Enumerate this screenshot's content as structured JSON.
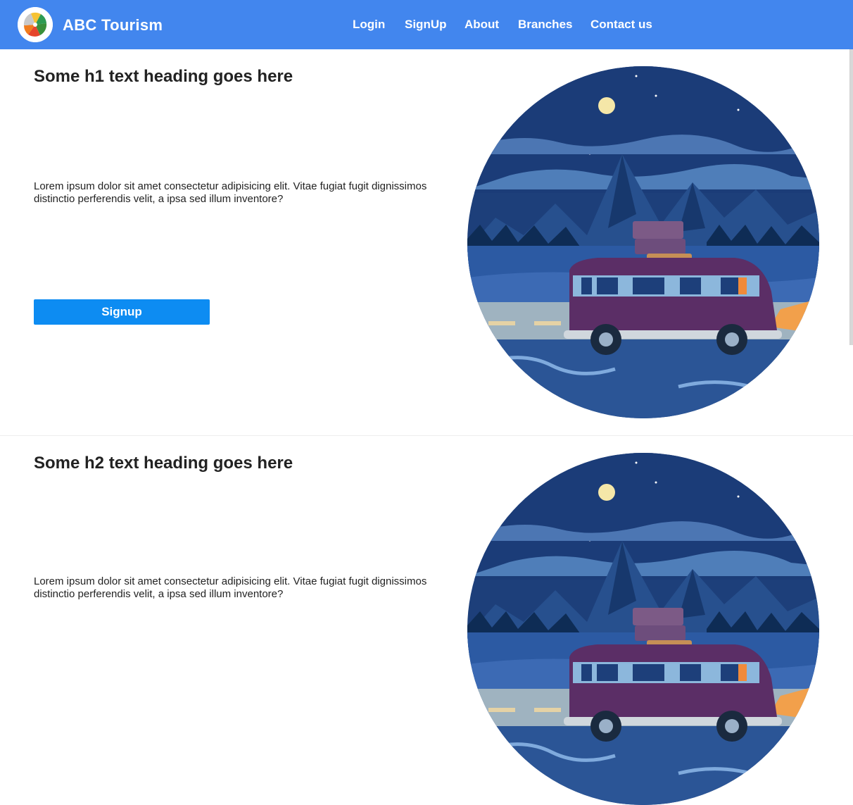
{
  "brand": {
    "name": "ABC Tourism",
    "logo_icon": "colorful-pinwheel-logo"
  },
  "nav": {
    "items": [
      {
        "label": "Login"
      },
      {
        "label": "SignUp"
      },
      {
        "label": "About"
      },
      {
        "label": "Branches"
      },
      {
        "label": "Contact us"
      }
    ]
  },
  "sections": [
    {
      "heading": "Some h1 text heading goes here",
      "text": "Lorem ipsum dolor sit amet consectetur adipisicing elit. Vitae fugiat fugit dignissimos distinctio perferendis velit, a ipsa sed illum inventore?",
      "button_label": "Signup",
      "image_icon": "night-van-mountain-illustration"
    },
    {
      "heading": "Some h2 text heading goes here",
      "text": "Lorem ipsum dolor sit amet consectetur adipisicing elit. Vitae fugiat fugit dignissimos distinctio perferendis velit, a ipsa sed illum inventore?",
      "image_icon": "night-van-mountain-illustration"
    }
  ],
  "colors": {
    "navbar": "#4286ee",
    "button": "#0d8cf2",
    "text": "#222222"
  }
}
